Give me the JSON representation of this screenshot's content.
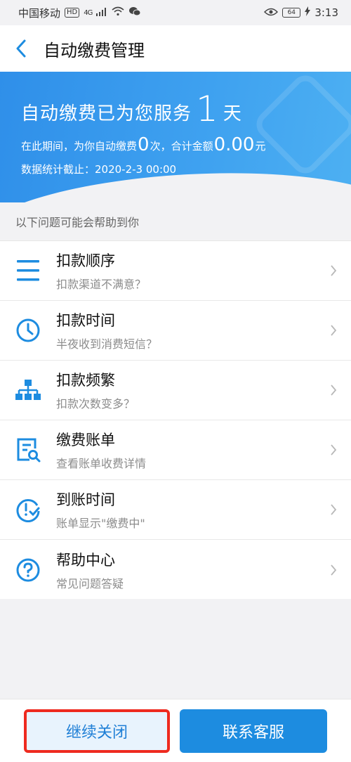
{
  "status_bar": {
    "carrier": "中国移动",
    "hd": "HD",
    "network": "4G",
    "battery": "64",
    "time": "3:13"
  },
  "nav": {
    "title": "自动缴费管理"
  },
  "hero": {
    "service_prefix": "自动缴费已为您服务",
    "service_days": "1",
    "service_suffix": "天",
    "period_prefix": "在此期间，为你自动缴费",
    "period_count": "0",
    "period_mid": "次，合计金额",
    "period_amount": "0.00",
    "period_unit": "元",
    "stats_line": "数据统计截止：2020-2-3 00:00"
  },
  "help": {
    "heading": "以下问题可能会帮助到你",
    "items": [
      {
        "title": "扣款顺序",
        "subtitle": "扣款渠道不满意？",
        "icon": "list-icon"
      },
      {
        "title": "扣款时间",
        "subtitle": "半夜收到消费短信？",
        "icon": "clock-icon"
      },
      {
        "title": "扣款频繁",
        "subtitle": "扣款次数变多？",
        "icon": "org-chart-icon"
      },
      {
        "title": "缴费账单",
        "subtitle": "查看账单收费详情",
        "icon": "bill-search-icon"
      },
      {
        "title": "到账时间",
        "subtitle": "账单显示\"缴费中\"",
        "icon": "clock-check-icon"
      },
      {
        "title": "帮助中心",
        "subtitle": "常见问题答疑",
        "icon": "question-icon"
      }
    ]
  },
  "buttons": {
    "close": "继续关闭",
    "contact": "联系客服"
  },
  "colors": {
    "accent": "#1d8ce0",
    "highlight_border": "#ee2a1f"
  }
}
